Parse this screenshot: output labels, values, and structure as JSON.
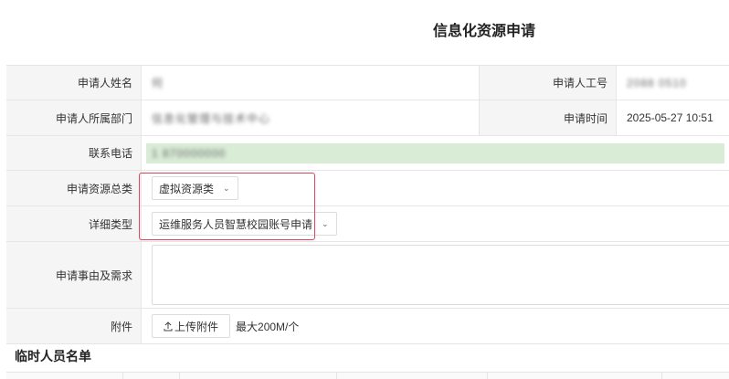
{
  "page": {
    "title": "信息化资源申请"
  },
  "form": {
    "applicant_name": {
      "label": "申请人姓名",
      "value": "何"
    },
    "employee_id": {
      "label": "申请人工号",
      "value": "2088 0510"
    },
    "department": {
      "label": "申请人所属部门",
      "value": "信息化管理与技术中心"
    },
    "apply_time": {
      "label": "申请时间",
      "value": "2025-05-27 10:51"
    },
    "phone": {
      "label": "联系电话",
      "value": "1 870000000"
    },
    "resource_category": {
      "label": "申请资源总类",
      "value": "虚拟资源类"
    },
    "detail_type": {
      "label": "详细类型",
      "value": "运维服务人员智慧校园账号申请"
    },
    "reason": {
      "label": "申请事由及需求",
      "value": ""
    },
    "attachment": {
      "label": "附件",
      "button": "上传附件",
      "hint": "最大200M/个"
    }
  },
  "section": {
    "title": "临时人员名单"
  },
  "colors": {
    "highlight": "#e0455a",
    "phone_bg": "#d9ecd6",
    "label_bg": "#f5f5f5"
  }
}
